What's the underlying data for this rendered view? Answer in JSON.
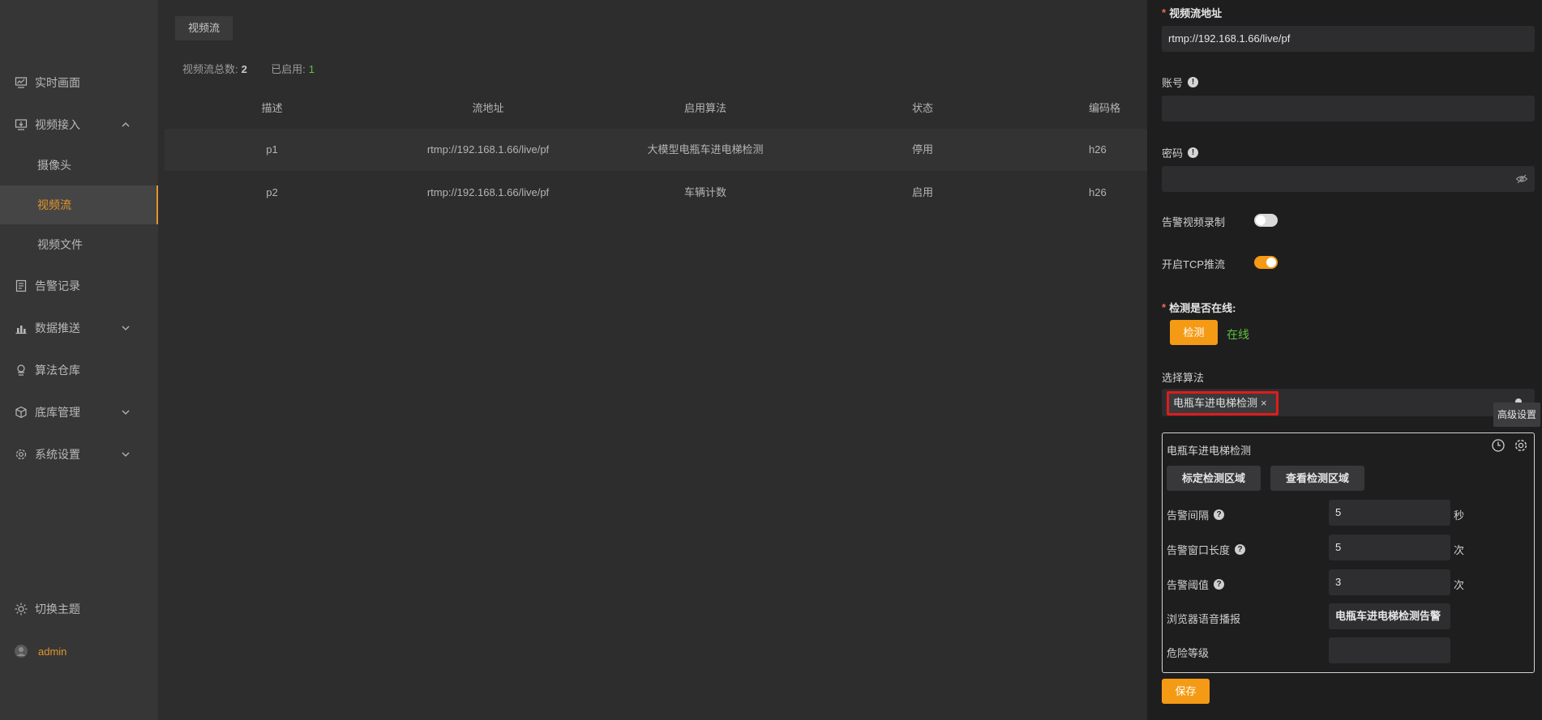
{
  "sidebar": {
    "items": [
      {
        "label": "实时画面",
        "icon": "monitor-chart-icon"
      },
      {
        "label": "视频接入",
        "icon": "video-input-icon",
        "expanded": true
      },
      {
        "label": "告警记录",
        "icon": "document-list-icon"
      },
      {
        "label": "数据推送",
        "icon": "bar-upload-icon"
      },
      {
        "label": "算法仓库",
        "icon": "brain-icon"
      },
      {
        "label": "底库管理",
        "icon": "cube-icon"
      },
      {
        "label": "系统设置",
        "icon": "gear-icon"
      }
    ],
    "sub_items": [
      {
        "label": "摄像头"
      },
      {
        "label": "视频流",
        "active": true
      },
      {
        "label": "视频文件"
      }
    ],
    "theme_label": "切换主题",
    "user_label": "admin"
  },
  "main": {
    "tab_label": "视频流",
    "stats": {
      "total_label": "视频流总数:",
      "total_value": "2",
      "enabled_label": "已启用:",
      "enabled_value": "1"
    },
    "table": {
      "headers": [
        "描述",
        "流地址",
        "启用算法",
        "状态",
        "编码格"
      ],
      "rows": [
        [
          "p1",
          "rtmp://192.168.1.66/live/pf",
          "大模型电瓶车进电梯检测",
          "停用",
          "h26"
        ],
        [
          "p2",
          "rtmp://192.168.1.66/live/pf",
          "车辆计数",
          "启用",
          "h26"
        ]
      ]
    }
  },
  "panel": {
    "stream_url_label": "视频流地址",
    "stream_url_value": "rtmp://192.168.1.66/live/pf",
    "account_label": "账号",
    "account_value": "",
    "password_label": "密码",
    "password_value": "",
    "alarm_record_label": "告警视频录制",
    "alarm_record_on": false,
    "tcp_label": "开启TCP推流",
    "tcp_on": true,
    "online_label": "检测是否在线:",
    "check_button": "检测",
    "online_status": "在线",
    "select_algo_label": "选择算法",
    "selected_tag": "电瓶车进电梯检测",
    "tag_close": "×",
    "tooltip": "高级设置",
    "algo_config": {
      "title": "电瓶车进电梯检测",
      "calibrate_button": "标定检测区域",
      "view_button": "查看检测区域",
      "alarm_interval_label": "告警间隔",
      "alarm_interval_value": "5",
      "alarm_interval_unit": "秒",
      "window_length_label": "告警窗口长度",
      "window_length_value": "5",
      "window_length_unit": "次",
      "threshold_label": "告警阈值",
      "threshold_value": "3",
      "threshold_unit": "次",
      "voice_label": "浏览器语音播报",
      "voice_value": "电瓶车进电梯检测告警",
      "danger_label": "危险等级",
      "danger_value": ""
    },
    "save_button": "保存"
  },
  "colors": {
    "accent": "#f59a15",
    "online": "#5dc23e",
    "highlight_border": "#e01b1b"
  }
}
